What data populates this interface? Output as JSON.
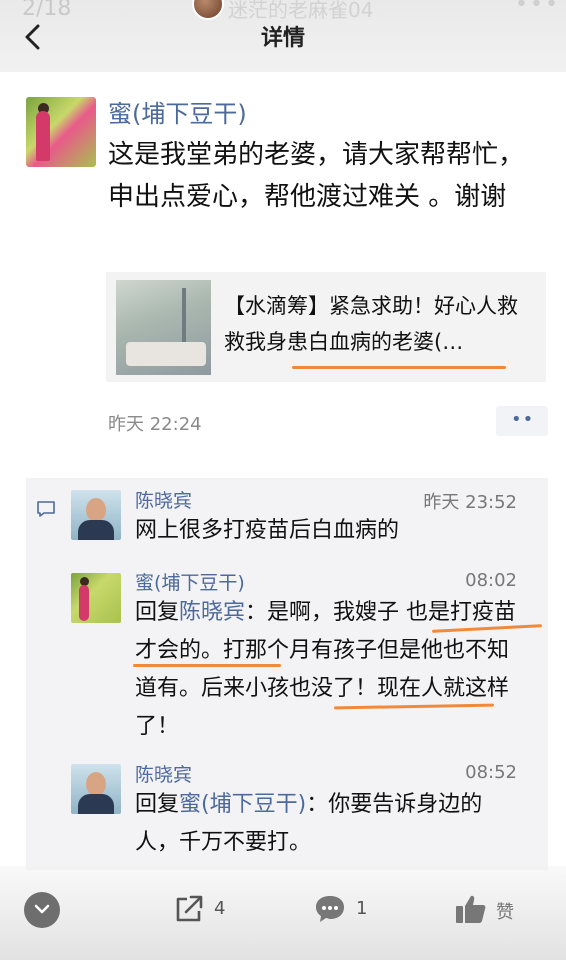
{
  "header": {
    "page_counter": "2/18",
    "poster_name": "迷茫的老麻雀04",
    "more": "•••",
    "title": "详情"
  },
  "post": {
    "author": "蜜(埔下豆干)",
    "body": "这是我堂弟的老婆，请大家帮帮忙，申出点爱心，帮他渡过难关 。谢谢",
    "link_title": "【水滴筹】紧急求助！好心人救救我身患白血病的老婆(…",
    "time": "昨天 22:24",
    "action_dots": "••"
  },
  "comments": [
    {
      "name": "陈晓宾",
      "time": "昨天 23:52",
      "text": "网上很多打疫苗后白血病的"
    },
    {
      "name": "蜜(埔下豆干)",
      "time": "08:02",
      "reply_prefix": "回复",
      "reply_to": "陈晓宾",
      "text": "：是啊，我嫂子 也是打疫苗才会的。打那个月有孩子但是他也不知道有。后来小孩也没了！现在人就这样了！"
    },
    {
      "name": "陈晓宾",
      "time": "08:52",
      "reply_prefix": "回复",
      "reply_to": "蜜(埔下豆干)",
      "text": "：你要告诉身边的人，千万不要打。"
    }
  ],
  "bottom_bar": {
    "share_count": "4",
    "comment_count": "1",
    "like_label": "赞"
  },
  "colors": {
    "name_blue": "#4d6a9d",
    "highlight_orange": "#f08a3a"
  },
  "icons": [
    "back-arrow-icon",
    "comment-bubble-icon",
    "chevron-down-icon",
    "share-icon",
    "message-icon",
    "thumbs-up-icon"
  ]
}
